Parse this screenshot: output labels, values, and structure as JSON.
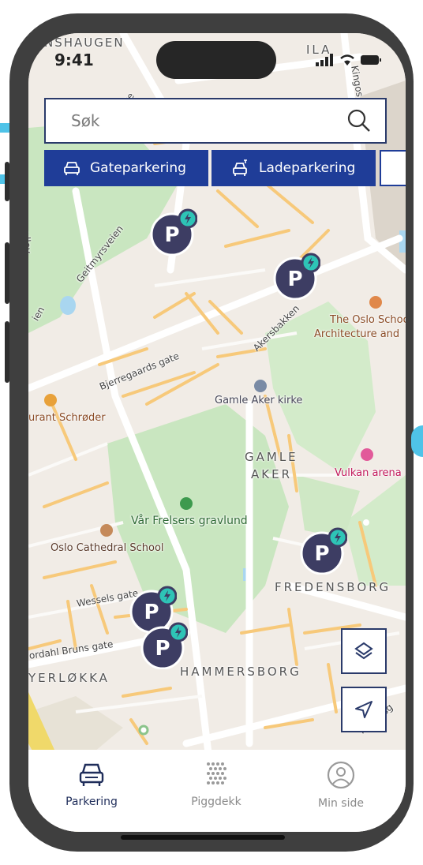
{
  "status_bar": {
    "time": "9:41",
    "area_label": "NSHAUGEN"
  },
  "search": {
    "placeholder": "Søk"
  },
  "filters": [
    {
      "label": "Gateparkering",
      "icon": "car-icon"
    },
    {
      "label": "Ladeparkering",
      "icon": "ev-car-icon"
    }
  ],
  "map_labels": {
    "districts": [
      "GAMLE",
      "AKER",
      "FREDENSBORG",
      "HAMMERSBORG",
      "YERLØKKA",
      "ILA"
    ],
    "streets": [
      "Geitmyrsveien",
      "Akersbakken",
      "Bjerregaards gate",
      "Wessels gate",
      "ordahl Bruns gate",
      "Marbosg",
      "gate",
      "Kingos",
      "ien",
      "ullev"
    ],
    "places": [
      "The Oslo School of",
      "Architecture and",
      "Gamle Aker kirke",
      "urant Schrøder",
      "Vulkan arena",
      "Vår Frelsers gravlund",
      "Oslo Cathedral School"
    ]
  },
  "map_controls": {
    "layers": "layers-icon",
    "locate": "navigation-arrow-icon"
  },
  "tabs": [
    {
      "label": "Parkering",
      "icon": "car-icon",
      "active": true
    },
    {
      "label": "Piggdekk",
      "icon": "studded-tire-icon",
      "active": false
    },
    {
      "label": "Min side",
      "icon": "user-circle-icon",
      "active": false
    }
  ],
  "colors": {
    "primary": "#1f3d98",
    "accent": "#4fc3e8",
    "pin": "#3d3d63",
    "ev_badge": "#2ec4b6",
    "park": "#c9e6c0",
    "road": "#f7c97a"
  }
}
